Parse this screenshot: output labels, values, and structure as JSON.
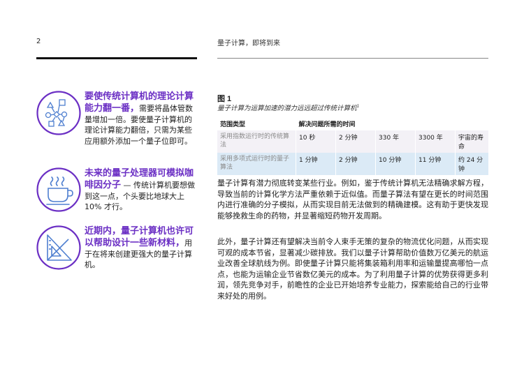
{
  "header": {
    "page_number": "2",
    "title": "量子计算，即将到来"
  },
  "facts": [
    {
      "icon": "shapes-network-icon",
      "highlight": "要使传统计算机的理论计算能力翻一番，",
      "body": "需要将晶体管数量增加一倍。要使量子计算机的理论计算能力翻倍，只需为某些应用额外添加一个量子位即可。"
    },
    {
      "icon": "coffee-cup-icon",
      "highlight": "未来的量子处理器可模拟咖啡因分子",
      "body": " — 传统计算机要想做到这一点，个头要比地球大上 10% 才行。"
    },
    {
      "icon": "drafting-triangle-icon",
      "highlight": "近期内，量子计算机也许可以帮助设计一些新材料，",
      "body": "用于在将来创建更强大的量子计算机。"
    }
  ],
  "figure": {
    "label": "图 1",
    "caption": "量子计算为运算加速的潜力远远超过传统计算机",
    "caption_note": "1",
    "col_header_type": "范围类型",
    "col_header_time": "解决问题所需的时间",
    "rows": [
      {
        "label": "采用指数运行时的传统算法",
        "values": [
          "10 秒",
          "2 分钟",
          "330 年",
          "3300 年",
          "宇宙的寿命"
        ]
      },
      {
        "label": "采用多项式运行时的量子算法",
        "values": [
          "1 分钟",
          "2 分钟",
          "10 分钟",
          "11 分钟",
          "约 24 分钟"
        ]
      }
    ]
  },
  "body": {
    "paragraph1": "量子计算有潜力彻底转变某些行业。例如，鉴于传统计算机无法精确求解方程，导致当前的计算化学方法严重依赖于近似值。而量子算法有望在更长的时间范围内进行准确的分子模拟，从而实现目前无法做到的精确建模。这有助于更快发现能够挽救生命的药物，并显著缩短药物开发周期。",
    "paragraph2": "此外，量子计算还有望解决当前令人束手无策的复杂的物流优化问题，从而实现可观的成本节省，显著减少碳排放。我们以量子计算帮助价值数万亿美元的航运业改善全球航线为例。即使量子计算只能将集装箱利用率和运输量提高哪怕一点点，也能为运输企业节省数亿美元的成本。为了利用量子计算的优势获得更多利润，领先竞争对手，前瞻性的企业已开始培养专业能力，探索能给自己的行业带来好处的用例。"
  },
  "colors": {
    "accent_purple": "#6b2fc4",
    "row1_bg": "#f3f1f6",
    "row2_bg": "#dbeaf6"
  }
}
